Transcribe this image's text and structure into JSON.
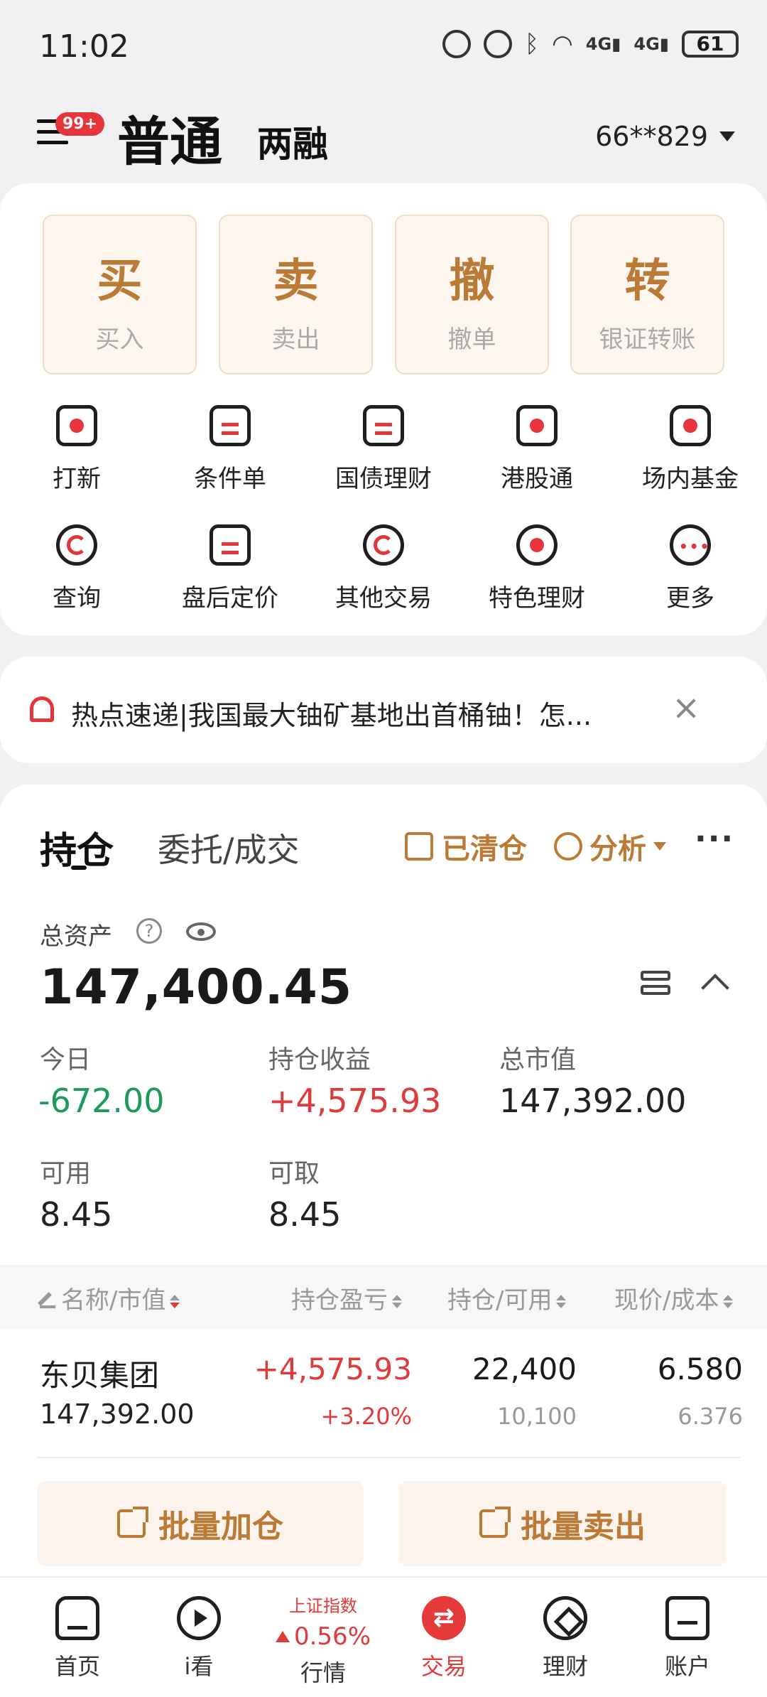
{
  "status_bar": {
    "time": "11:02",
    "battery": "61"
  },
  "header": {
    "badge": "99+",
    "tab_normal": "普通",
    "tab_margin": "两融",
    "account": "66**829"
  },
  "main_actions": [
    {
      "char": "买",
      "label": "买入"
    },
    {
      "char": "卖",
      "label": "卖出"
    },
    {
      "char": "撤",
      "label": "撤单"
    },
    {
      "char": "转",
      "label": "银证转账"
    }
  ],
  "tools": [
    {
      "label": "打新",
      "icon": "ipo-subscribe-icon"
    },
    {
      "label": "条件单",
      "icon": "conditional-order-icon"
    },
    {
      "label": "国债理财",
      "icon": "treasury-bond-icon"
    },
    {
      "label": "港股通",
      "icon": "hk-connect-icon"
    },
    {
      "label": "场内基金",
      "icon": "etf-fund-icon"
    },
    {
      "label": "查询",
      "icon": "query-icon"
    },
    {
      "label": "盘后定价",
      "icon": "after-hours-pricing-icon"
    },
    {
      "label": "其他交易",
      "icon": "other-trades-icon"
    },
    {
      "label": "特色理财",
      "icon": "featured-wealth-icon"
    },
    {
      "label": "更多",
      "icon": "more-icon"
    }
  ],
  "news": {
    "text": "热点速递|我国最大铀矿基地出首桶铀！怎..."
  },
  "holdings": {
    "tab_positions": "持仓",
    "tab_orders": "委托/成交",
    "cleared": "已清仓",
    "analysis": "分析",
    "total_label": "总资产",
    "total_value": "147,400.45",
    "stats": {
      "today_label": "今日",
      "today_value": "-672.00",
      "pos_profit_label": "持仓收益",
      "pos_profit_value": "+4,575.93",
      "market_value_label": "总市值",
      "market_value_value": "147,392.00",
      "available_label": "可用",
      "available_value": "8.45",
      "withdrawable_label": "可取",
      "withdrawable_value": "8.45"
    },
    "columns": [
      "名称/市值",
      "持仓盈亏",
      "持仓/可用",
      "现价/成本"
    ],
    "rows": [
      {
        "name": "东贝集团",
        "market_value": "147,392.00",
        "pl": "+4,575.93",
        "pl_pct": "+3.20%",
        "position": "22,400",
        "available": "10,100",
        "price": "6.580",
        "cost": "6.376"
      }
    ],
    "batch_add": "批量加仓",
    "batch_sell": "批量卖出"
  },
  "bottom_nav": {
    "home": "首页",
    "watch": "i看",
    "market_index_name": "上证指数",
    "market_index_change": "0.56%",
    "market": "行情",
    "trade": "交易",
    "wealth": "理财",
    "account": "账户"
  },
  "colors": {
    "accent_gold": "#bb7a36",
    "up_red": "#e03a3a",
    "down_green": "#1b9a58"
  }
}
